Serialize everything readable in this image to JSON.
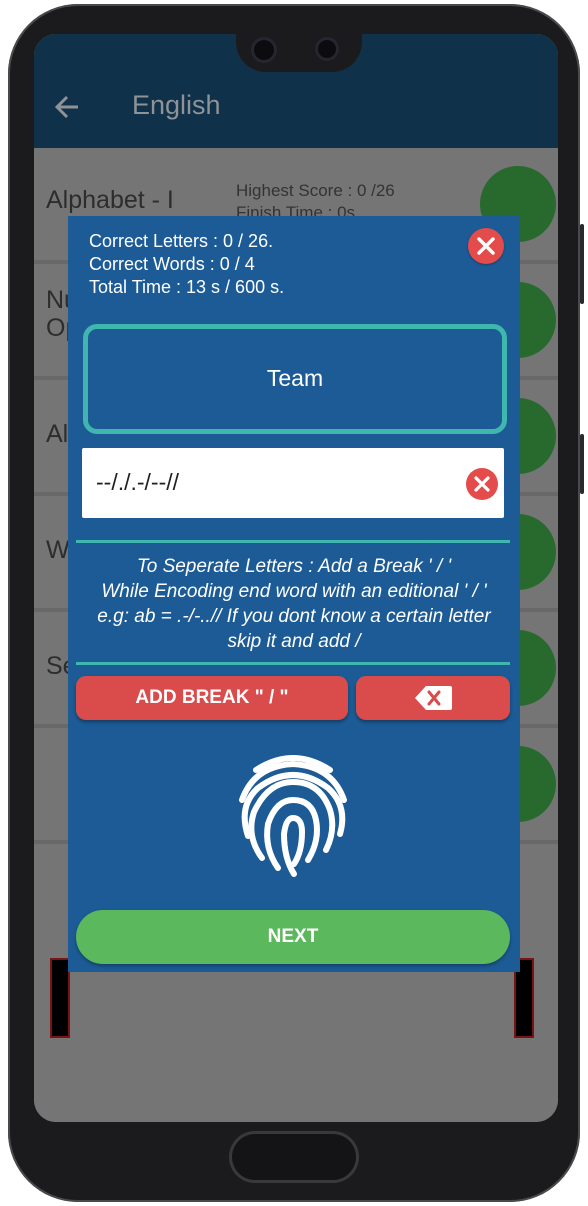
{
  "app": {
    "title": "English",
    "colors": {
      "appbar": "#0f3149",
      "dialog": "#1c5b95",
      "accent": "#3fb7ae",
      "danger": "#da4c4c",
      "success": "#5cb85c"
    }
  },
  "list": {
    "items": [
      {
        "label": "Alphabet - I"
      },
      {
        "label": "Nu"
      },
      {
        "label": "Op"
      },
      {
        "label": "Al"
      },
      {
        "label": "W"
      },
      {
        "label": "Se"
      }
    ],
    "score": {
      "highest": "Highest Score : 0 /26",
      "finish": "Finish Time : 0s"
    }
  },
  "dialog": {
    "correct_letters": "Correct Letters : 0 / 26.",
    "correct_words": "Correct Words : 0 / 4",
    "total_time": "Total Time : 13 s / 600 s.",
    "word": "Team",
    "input_value": "--/./.-/--//",
    "instructions": {
      "line1": "To Seperate Letters : Add a Break  ' / '",
      "line2": "While Encoding end word with an editional ' / '",
      "line3": "e.g: ab = .-/-..// If you dont know a certain letter",
      "line4": "skip it and add /"
    },
    "add_break_label": "ADD  BREAK \" / \"",
    "next_label": "NEXT"
  },
  "icons": [
    "back-arrow-icon",
    "lock-icon",
    "close-icon",
    "clear-icon",
    "backspace-icon",
    "fingerprint-icon"
  ]
}
